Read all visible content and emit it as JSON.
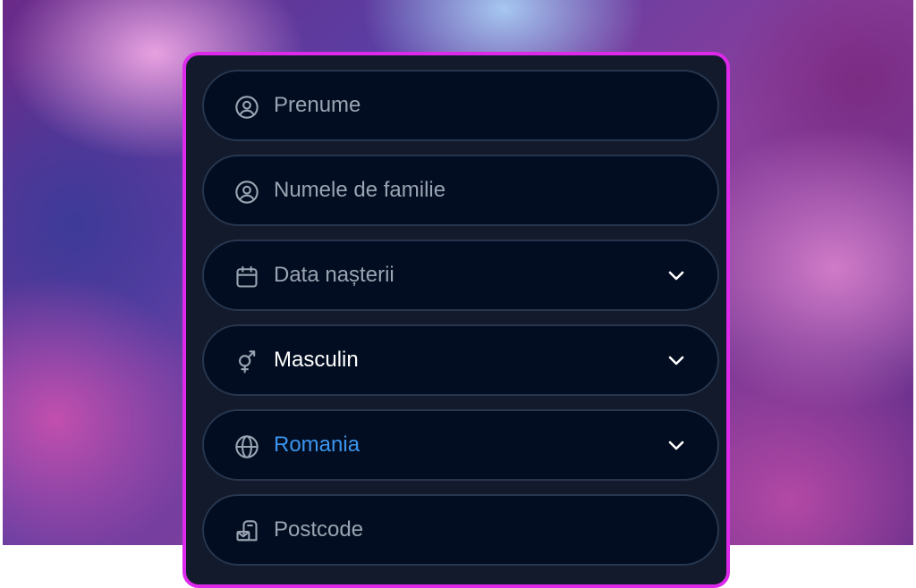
{
  "form": {
    "first_name": {
      "placeholder": "Prenume",
      "icon": "user-circle-icon"
    },
    "last_name": {
      "placeholder": "Numele de familie",
      "icon": "user-circle-icon"
    },
    "birth_date": {
      "placeholder": "Data nașterii",
      "icon": "calendar-icon"
    },
    "gender": {
      "value": "Masculin",
      "icon": "gender-icon"
    },
    "country": {
      "value": "Romania",
      "icon": "globe-icon"
    },
    "postcode": {
      "placeholder": "Postcode",
      "icon": "mailbox-icon"
    }
  },
  "colors": {
    "card_border": "#dc29ea",
    "field_bg": "#020d21",
    "field_border": "#27364e",
    "placeholder": "#9aa4b2",
    "value": "#ffffff",
    "country_accent": "#3b95ef"
  }
}
